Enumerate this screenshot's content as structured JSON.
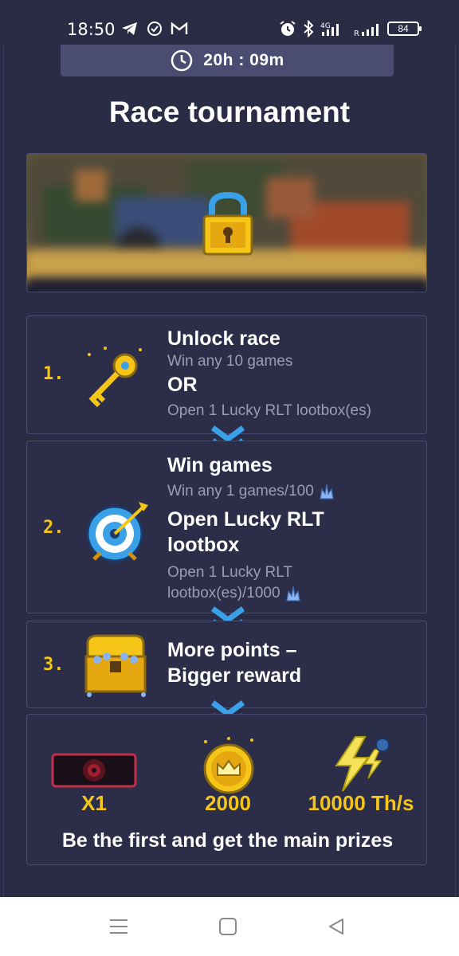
{
  "status_bar": {
    "time": "18:50",
    "battery": "84",
    "left_icons": [
      "telegram-icon",
      "check-circle-icon",
      "gmail-icon"
    ],
    "right_icons": [
      "alarm-icon",
      "bluetooth-icon",
      "signal-4g-icon",
      "signal-icon",
      "battery-icon"
    ]
  },
  "timer": {
    "text": "20h : 09m",
    "icon": "clock-icon"
  },
  "page": {
    "title": "Race tournament"
  },
  "banner": {
    "icon": "lock-icon"
  },
  "steps": [
    {
      "number": "1.",
      "icon": "key-icon",
      "heading": "Unlock race",
      "line1": "Win any 10 games",
      "or": "OR",
      "line2": "Open 1 Lucky RLT lootbox(es)"
    },
    {
      "number": "2.",
      "icon": "target-icon",
      "heading1": "Win games",
      "line1": "Win any 1 games/100",
      "heading2a": "Open Lucky RLT",
      "heading2b": "lootbox",
      "line2a": "Open 1 Lucky RLT",
      "line2b": "lootbox(es)/1000",
      "points_icon": "crystal-icon"
    },
    {
      "number": "3.",
      "icon": "treasure-chest-icon",
      "heading1": "More points –",
      "heading2": "Bigger reward"
    }
  ],
  "prizes": {
    "items": [
      {
        "icon": "card-icon",
        "label": "X1"
      },
      {
        "icon": "coin-icon",
        "label": "2000"
      },
      {
        "icon": "lightning-icon",
        "label": "10000 Th/s"
      }
    ],
    "footer": "Be the first and get the main prizes"
  },
  "colors": {
    "accent": "#f5c518",
    "background": "#2a2b45",
    "chevron": "#3aa0e8"
  },
  "nav": {
    "icons": [
      "menu-icon",
      "home-icon",
      "back-icon"
    ]
  }
}
